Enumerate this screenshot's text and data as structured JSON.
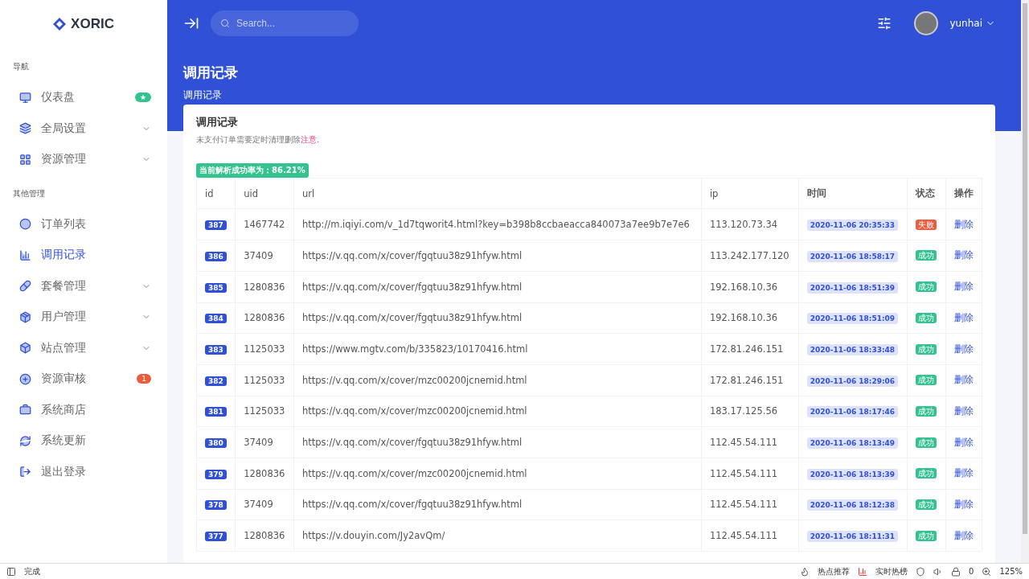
{
  "sidebar": {
    "logo": "XORIC",
    "sections": [
      {
        "title": "导航",
        "items": [
          {
            "label": "仪表盘",
            "selected": false,
            "expandable": false,
            "badge": {
              "text": "★",
              "kind": "success"
            }
          },
          {
            "label": "全局设置",
            "selected": false,
            "expandable": true
          },
          {
            "label": "资源管理",
            "selected": false,
            "expandable": true
          }
        ]
      },
      {
        "title": "其他管理",
        "items": [
          {
            "label": "订单列表",
            "selected": false,
            "expandable": false
          },
          {
            "label": "调用记录",
            "selected": true,
            "expandable": false
          },
          {
            "label": "套餐管理",
            "selected": false,
            "expandable": true
          },
          {
            "label": "用户管理",
            "selected": false,
            "expandable": true
          },
          {
            "label": "站点管理",
            "selected": false,
            "expandable": true
          },
          {
            "label": "资源审核",
            "selected": false,
            "expandable": false,
            "badge": {
              "text": "1",
              "kind": "danger"
            }
          },
          {
            "label": "系统商店",
            "selected": false,
            "expandable": false
          },
          {
            "label": "系统更新",
            "selected": false,
            "expandable": false
          },
          {
            "label": "退出登录",
            "selected": false,
            "expandable": false
          }
        ]
      }
    ]
  },
  "topbar": {
    "search": {
      "placeholder": "Search..."
    },
    "user": "yunhai"
  },
  "page": {
    "title": "调用记录",
    "breadcrumb": "调用记录"
  },
  "card": {
    "title": "调用记录",
    "note": "未支付订单需要定时清理删除",
    "note_link": "注意",
    "note_end": ".",
    "success_rate": "当前解析成功率为：86.21%",
    "table": {
      "columns": [
        "id",
        "uid",
        "url",
        "ip",
        "时间",
        "状态",
        "操作"
      ],
      "rows": [
        {
          "id": "387",
          "uid": "1467742",
          "url": "http://m.iqiyi.com/v_1d7tqworit4.html?key=b398b8ccbaeacca840073a7ee9b7e7e6",
          "ip": "113.120.73.34",
          "time": "2020-11-06 20:35:33",
          "status": {
            "label": "失败",
            "kind": "fail"
          },
          "action": "删除"
        },
        {
          "id": "386",
          "uid": "37409",
          "url": "https://v.qq.com/x/cover/fgqtuu38z91hfyw.html",
          "ip": "113.242.177.120",
          "time": "2020-11-06 18:58:17",
          "status": {
            "label": "成功",
            "kind": "success"
          },
          "action": "删除"
        },
        {
          "id": "385",
          "uid": "1280836",
          "url": "https://v.qq.com/x/cover/fgqtuu38z91hfyw.html",
          "ip": "192.168.10.36",
          "time": "2020-11-06 18:51:39",
          "status": {
            "label": "成功",
            "kind": "success"
          },
          "action": "删除"
        },
        {
          "id": "384",
          "uid": "1280836",
          "url": "https://v.qq.com/x/cover/fgqtuu38z91hfyw.html",
          "ip": "192.168.10.36",
          "time": "2020-11-06 18:51:09",
          "status": {
            "label": "成功",
            "kind": "success"
          },
          "action": "删除"
        },
        {
          "id": "383",
          "uid": "1125033",
          "url": "https://www.mgtv.com/b/335823/10170416.html",
          "ip": "172.81.246.151",
          "time": "2020-11-06 18:33:48",
          "status": {
            "label": "成功",
            "kind": "success"
          },
          "action": "删除"
        },
        {
          "id": "382",
          "uid": "1125033",
          "url": "https://v.qq.com/x/cover/mzc00200jcnemid.html",
          "ip": "172.81.246.151",
          "time": "2020-11-06 18:29:06",
          "status": {
            "label": "成功",
            "kind": "success"
          },
          "action": "删除"
        },
        {
          "id": "381",
          "uid": "1125033",
          "url": "https://v.qq.com/x/cover/mzc00200jcnemid.html",
          "ip": "183.17.125.56",
          "time": "2020-11-06 18:17:46",
          "status": {
            "label": "成功",
            "kind": "success"
          },
          "action": "删除"
        },
        {
          "id": "380",
          "uid": "37409",
          "url": "https://v.qq.com/x/cover/fgqtuu38z91hfyw.html",
          "ip": "112.45.54.111",
          "time": "2020-11-06 18:13:49",
          "status": {
            "label": "成功",
            "kind": "success"
          },
          "action": "删除"
        },
        {
          "id": "379",
          "uid": "1280836",
          "url": "https://v.qq.com/x/cover/mzc00200jcnemid.html",
          "ip": "112.45.54.111",
          "time": "2020-11-06 18:13:39",
          "status": {
            "label": "成功",
            "kind": "success"
          },
          "action": "删除"
        },
        {
          "id": "378",
          "uid": "37409",
          "url": "https://v.qq.com/x/cover/fgqtuu38z91hfyw.html",
          "ip": "112.45.54.111",
          "time": "2020-11-06 18:12:38",
          "status": {
            "label": "成功",
            "kind": "success"
          },
          "action": "删除"
        },
        {
          "id": "377",
          "uid": "1280836",
          "url": "https://v.douyin.com/Jy2avQm/",
          "ip": "112.45.54.111",
          "time": "2020-11-06 18:11:31",
          "status": {
            "label": "成功",
            "kind": "success"
          },
          "action": "删除"
        }
      ]
    }
  },
  "status_bar": {
    "left": "完成",
    "items": [
      "热点推荐",
      "实时热榜"
    ],
    "count": "0",
    "zoom": "125%"
  }
}
